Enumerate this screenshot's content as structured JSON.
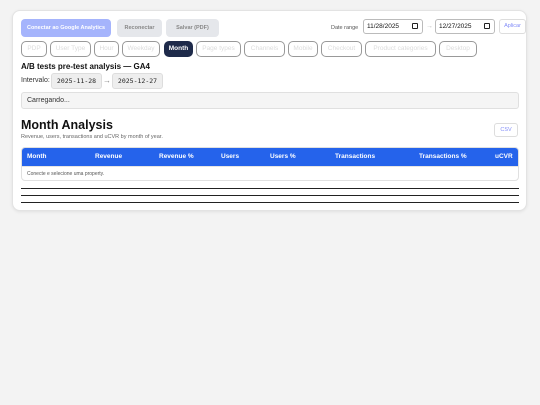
{
  "toolbar": {
    "connect_label": "Conectar ao Google Analytics",
    "reconnect_label": "Reconectar",
    "save_pdf_label": "Salvar (PDF)",
    "date_range_label": "Date range",
    "date_start": "11/28/2025",
    "date_end": "12/27/2025",
    "date_separator": "→",
    "apply_label": "Aplicar"
  },
  "tabs": [
    {
      "label": "PDP",
      "active": false
    },
    {
      "label": "User Type",
      "active": false
    },
    {
      "label": "Hour",
      "active": false
    },
    {
      "label": "Weekday",
      "active": false
    },
    {
      "label": "Month",
      "active": true
    },
    {
      "label": "Page types",
      "active": false
    },
    {
      "label": "Channels",
      "active": false
    },
    {
      "label": "Mobile",
      "active": false
    },
    {
      "label": "Checkout",
      "active": false
    },
    {
      "label": "Product categories",
      "active": false
    },
    {
      "label": "Desktop",
      "active": false
    }
  ],
  "report": {
    "title": "A/B tests pre-test analysis — GA4",
    "interval_label": "Intervalo:",
    "interval_start": "2025-11-28",
    "interval_arrow": "→",
    "interval_end": "2025-12-27",
    "loading_text": "Carregando..."
  },
  "section": {
    "title": "Month Analysis",
    "subtitle": "Revenue, users, transactions and uCVR by month of year.",
    "csv_label": "CSV"
  },
  "table": {
    "columns": [
      "Month",
      "Revenue",
      "Revenue %",
      "Users",
      "Users %",
      "Transactions",
      "Transactions %",
      "uCVR"
    ],
    "empty_message": "Conecte e selecione uma property."
  },
  "colors": {
    "primary_button": "#a5b4fc",
    "active_tab": "#1e2a4a",
    "table_header": "#2563eb",
    "link_accent": "#818cf8"
  }
}
